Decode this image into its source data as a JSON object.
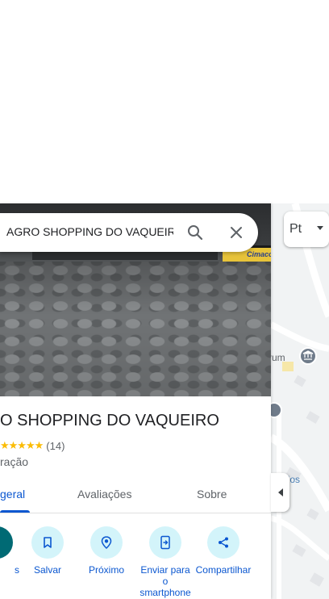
{
  "search": {
    "query": "AGRO SHOPPING DO VAQUEIRO"
  },
  "hero": {
    "sign_text": "Cimaco"
  },
  "place": {
    "title": "O SHOPPING DO VAQUEIRO",
    "stars": "★★★★★",
    "rating_count": "(14)",
    "category": "ração"
  },
  "tabs": [
    {
      "label": "geral",
      "active": true
    },
    {
      "label": "Avaliações",
      "active": false
    },
    {
      "label": "Sobre",
      "active": false
    }
  ],
  "actions": [
    {
      "label": "s",
      "icon": "directions-icon"
    },
    {
      "label": "Salvar",
      "icon": "bookmark-icon"
    },
    {
      "label": "Próximo",
      "icon": "nearby-icon"
    },
    {
      "label": "Enviar para o smartphone",
      "icon": "send-to-phone-icon"
    },
    {
      "label": "Compartilhar",
      "icon": "share-icon"
    }
  ],
  "map": {
    "language_button": "Pt",
    "labels": [
      "rum",
      "rcados"
    ]
  },
  "colors": {
    "accent": "#0b57d0",
    "action_bg": "#d3f4fa",
    "star": "#fbbc04",
    "directions_bg": "#006a74"
  }
}
